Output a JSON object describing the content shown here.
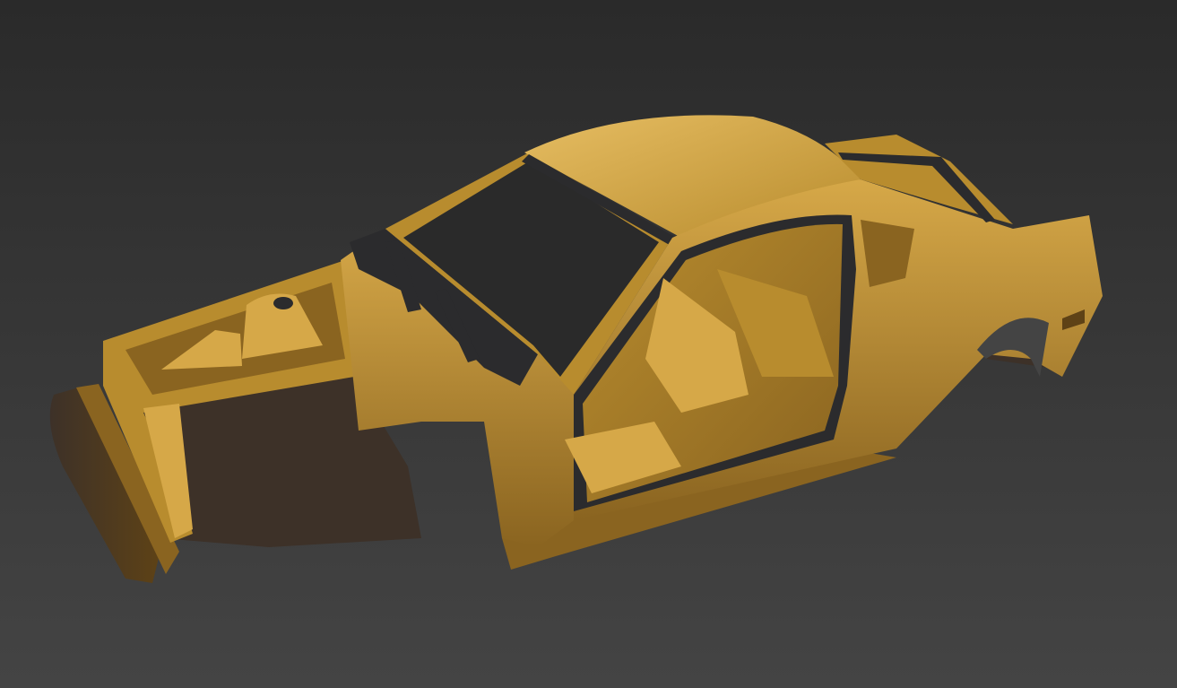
{
  "scene": {
    "subject": "car-body-shell-3d-render",
    "colors": {
      "background_top": "#2a2a2a",
      "background_bottom": "#444444",
      "body_base": "#b88c2e",
      "body_light": "#d6a848",
      "body_highlight": "#e6bd62",
      "body_shadow": "#8a6420",
      "body_deep": "#5e4216",
      "rubber_seal": "#2b2b2d",
      "undercarriage": "#3d3128"
    }
  }
}
